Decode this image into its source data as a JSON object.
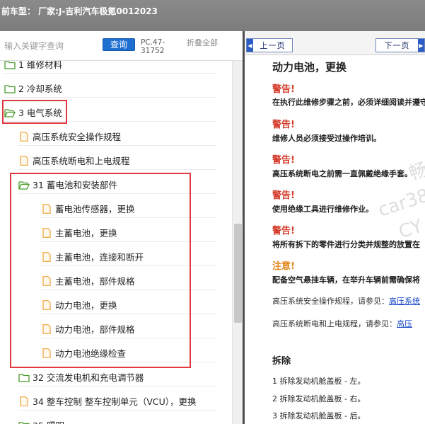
{
  "title": "前车型：  厂家:J-吉利汽车极氪0012023",
  "search": {
    "placeholder": "输入关键字查询",
    "button_label": "查询",
    "doc_code": "PC.47-31752",
    "collapse_all_label": "折叠全部"
  },
  "tree": [
    {
      "label": "1 维修材料",
      "type": "folder"
    },
    {
      "label": "2 冷却系统",
      "type": "folder"
    },
    {
      "label": "3 电气系统",
      "type": "folder-open"
    },
    {
      "label": "高压系统安全操作规程",
      "type": "doc"
    },
    {
      "label": "高压系统断电和上电规程",
      "type": "doc"
    },
    {
      "label": "31 蓄电池和安装部件",
      "type": "folder-open"
    },
    {
      "label": "蓄电池传感器，更换",
      "type": "doc"
    },
    {
      "label": "主蓄电池，更换",
      "type": "doc"
    },
    {
      "label": "主蓄电池，连接和断开",
      "type": "doc"
    },
    {
      "label": "主蓄电池，部件规格",
      "type": "doc"
    },
    {
      "label": "动力电池，更换",
      "type": "doc"
    },
    {
      "label": "动力电池，部件规格",
      "type": "doc"
    },
    {
      "label": "动力电池绝缘检查",
      "type": "doc"
    },
    {
      "label": "32 交流发电机和充电调节器",
      "type": "folder"
    },
    {
      "label": "34 整车控制 整车控制单元（VCU），更换",
      "type": "doc"
    },
    {
      "label": "35 照明",
      "type": "folder"
    }
  ],
  "nav": {
    "prev_label": "上一页",
    "next_label": "下一页"
  },
  "doc": {
    "title": "动力电池，更换",
    "warnings": [
      {
        "label": "警告!",
        "text": "在执行此维修步骤之前，必须详细阅读并遵守"
      },
      {
        "label": "警告!",
        "text": "维修人员必须接受过操作培训。"
      },
      {
        "label": "警告!",
        "text": "高压系统断电之前需一直佩戴绝缘手套。"
      },
      {
        "label": "警告!",
        "text": "使用绝缘工具进行维修作业。"
      },
      {
        "label": "警告!",
        "text": "将所有拆下的零件进行分类并规整的放置在"
      },
      {
        "label": "注意!",
        "text": "配备空气悬挂车辆，在举升车辆前需确保将"
      }
    ],
    "refs": [
      {
        "text": "高压系统安全操作规程，请参见：",
        "link": "高压系统"
      },
      {
        "text": "高压系统断电和上电规程，请参见：",
        "link": "高压"
      }
    ],
    "section": "拆除",
    "steps": [
      "1  拆除发动机舱盖板 - 左。",
      "2  拆除发动机舱盖板 - 右。",
      "3  拆除发动机舱盖板 - 后。"
    ],
    "watermark": [
      "畅",
      "car38",
      "CY"
    ]
  },
  "colors": {
    "highlight_border": "#e0393f",
    "search_button": "#1e6fd0",
    "warning": "#d43a2a",
    "notice": "#e0851a",
    "link": "#1848c8",
    "folder": "#4a9a2a",
    "doc_icon": "#f0a23a"
  }
}
